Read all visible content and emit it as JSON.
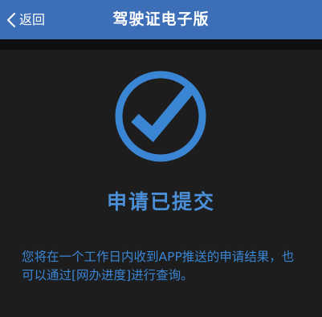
{
  "header": {
    "back_label": "返回",
    "title": "驾驶证电子版"
  },
  "status": {
    "title": "申请已提交",
    "message": "您将在一个工作日内收到APP推送的申请结果，也可以通过[网办进度]进行查询。"
  },
  "icons": {
    "back": "chevron-left-icon",
    "status": "checkmark-circle-icon"
  },
  "colors": {
    "header_bg": "#3d6fb8",
    "accent": "#3b86d4",
    "panel_bg": "#1d1d1d",
    "page_bg": "#0b0b0b"
  }
}
